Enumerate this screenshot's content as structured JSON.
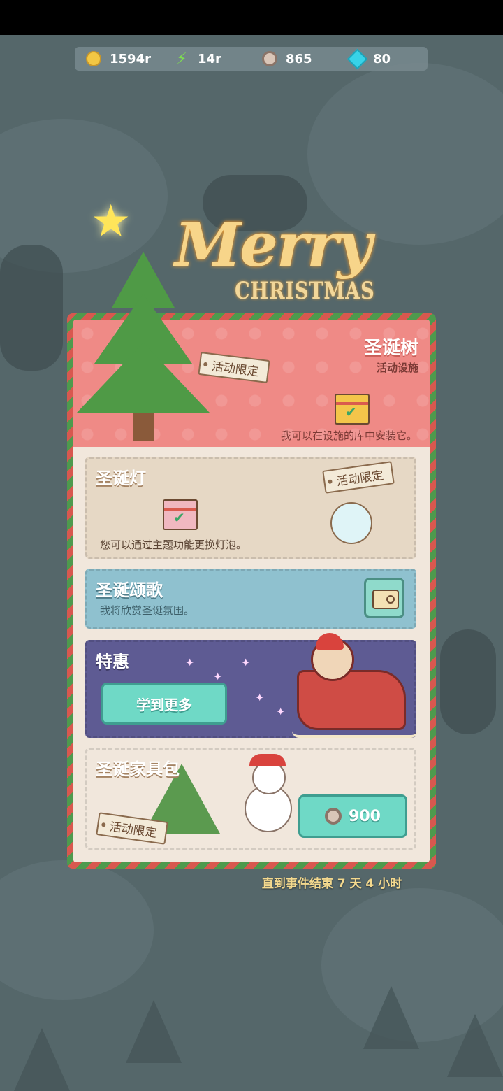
{
  "resources": [
    {
      "icon": "coin-icon",
      "value": "1594r"
    },
    {
      "icon": "lightning-icon",
      "value": "14r"
    },
    {
      "icon": "gear-token-icon",
      "value": "865"
    },
    {
      "icon": "gem-icon",
      "value": "80"
    }
  ],
  "banner": {
    "merry": "Merry",
    "christmas": "CHRISTMAS"
  },
  "hero": {
    "title": "圣诞树",
    "subtitle": "活动设施",
    "tag": "活动限定",
    "description": "我可以在设施的库中安装它。"
  },
  "lights": {
    "title": "圣诞灯",
    "tag": "活动限定",
    "description": "您可以通过主题功能更换灯泡。"
  },
  "carols": {
    "title": "圣诞颂歌",
    "description": "我将欣赏圣诞氛围。"
  },
  "offer": {
    "title": "特惠",
    "button": "学到更多"
  },
  "furniture": {
    "title": "圣诞家具包",
    "tag": "活动限定",
    "price": "900"
  },
  "countdown": "直到事件结束 7 天 4 小时",
  "colors": {
    "accent_teal": "#6fd9c6",
    "hero_pink": "#ef8a86",
    "offer_purple": "#5e5b93",
    "carol_blue": "#8fc1cf"
  }
}
